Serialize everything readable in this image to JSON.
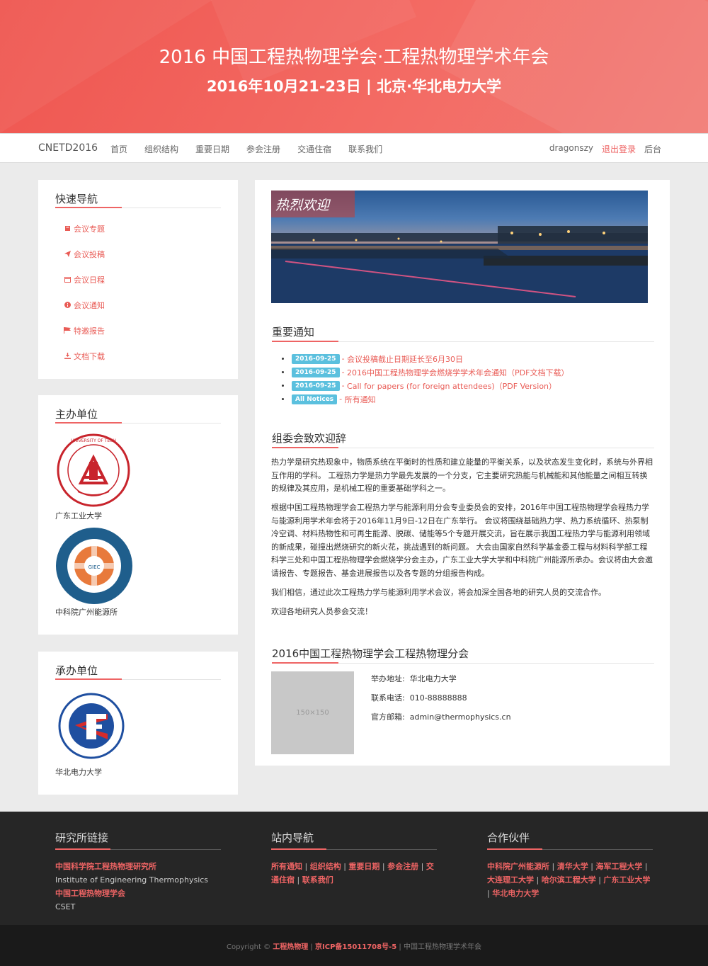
{
  "header": {
    "title": "2016 中国工程热物理学会·工程热物理学术年会",
    "subtitle": "2016年10月21-23日 | 北京·华北电力大学"
  },
  "navbar": {
    "brand": "CNETD2016",
    "items": [
      "首页",
      "组织结构",
      "重要日期",
      "参会注册",
      "交通住宿",
      "联系我们"
    ],
    "user": "dragonszy",
    "logout": "退出登录",
    "admin": "后台"
  },
  "quick_nav": {
    "title": "快速导航",
    "items": [
      {
        "label": "会议专题",
        "icon": "book-icon"
      },
      {
        "label": "会议投稿",
        "icon": "send-icon"
      },
      {
        "label": "会议日程",
        "icon": "calendar-icon"
      },
      {
        "label": "会议通知",
        "icon": "info-icon"
      },
      {
        "label": "特邀报告",
        "icon": "flag-icon"
      },
      {
        "label": "文档下载",
        "icon": "download-icon"
      }
    ]
  },
  "sponsors": {
    "title": "主办单位",
    "items": [
      "广东工业大学",
      "中科院广州能源所"
    ]
  },
  "organizers": {
    "title": "承办单位",
    "items": [
      "华北电力大学"
    ]
  },
  "banner": {
    "caption": "热烈欢迎"
  },
  "notices": {
    "title": "重要通知",
    "items": [
      {
        "date": "2016-09-25",
        "text": "会议投稿截止日期延长至6月30日"
      },
      {
        "date": "2016-09-25",
        "text": "2016中国工程热物理学会燃烧学学术年会通知（PDF文档下载）"
      },
      {
        "date": "2016-09-25",
        "text": "Call for papers (for foreign attendees)（PDF Version）"
      },
      {
        "date": "All Notices",
        "text": "所有通知"
      }
    ]
  },
  "welcome": {
    "title": "组委会致欢迎辞",
    "paragraphs": [
      "热力学是研究热现象中，物质系统在平衡时的性质和建立能量的平衡关系，以及状态发生变化时，系统与外界相互作用的学科。 工程热力学是热力学最先发展的一个分支，它主要研究热能与机械能和其他能量之间相互转换的规律及其应用，是机械工程的重要基础学科之一。",
      "根据中国工程热物理学会工程热力学与能源利用分会专业委员会的安排，2016年中国工程热物理学会程热力学与能源利用学术年会将于2016年11月9日-12日在广东举行。 会议将围绕基础热力学、热力系统循环、热泵制冷空调、材料热物性和可再生能源、脱碳、储能等5个专题开展交流，旨在展示我国工程热力学与能源利用领域的新成果，碰撞出燃烧研究的新火花，挑战遇到的新问题。 大会由国家自然科学基金委工程与材料科学部工程科学三处和中国工程热物理学会燃烧学分会主办，广东工业大学大学和中科院广州能源所承办。会议将由大会邀请报告、专题报告、基金进展报告以及各专题的分组报告构成。",
      "我们相信，通过此次工程热力学与能源利用学术会议，将会加深全国各地的研究人员的交流合作。",
      "欢迎各地研究人员参会交流！"
    ]
  },
  "contact": {
    "title": "2016中国工程热物理学会工程热物理分会",
    "placeholder": "150×150",
    "address_label": "举办地址:",
    "address": "华北电力大学",
    "phone_label": "联系电话:",
    "phone": "010-88888888",
    "email_label": "官方邮箱:",
    "email": "admin@thermophysics.cn"
  },
  "footer": {
    "col1": {
      "title": "研究所链接",
      "links": [
        {
          "text": "中国科学院工程热物理研究所",
          "style": "r"
        },
        {
          "text": "Institute of Engineering Thermophysics",
          "style": "w"
        },
        {
          "text": "中国工程热物理学会",
          "style": "r"
        },
        {
          "text": "CSET",
          "style": "w"
        }
      ]
    },
    "col2": {
      "title": "站内导航",
      "links": [
        "所有通知",
        "组织结构",
        "重要日期",
        "参会注册",
        "交通住宿",
        "联系我们"
      ]
    },
    "col3": {
      "title": "合作伙伴",
      "links": [
        "中科院广州能源所",
        "清华大学",
        "海军工程大学",
        "大连理工大学",
        "哈尔滨工程大学",
        "广东工业大学",
        "华北电力大学"
      ]
    },
    "copyright_prefix": "Copyright ©",
    "copyright_org": "工程热物理",
    "icp": "京ICP备15011708号-5",
    "copyright_suffix": "中国工程热物理学术年会"
  },
  "colors": {
    "accent": "#ee6464",
    "badge": "#5bc0de",
    "footer_bg": "#262626"
  }
}
